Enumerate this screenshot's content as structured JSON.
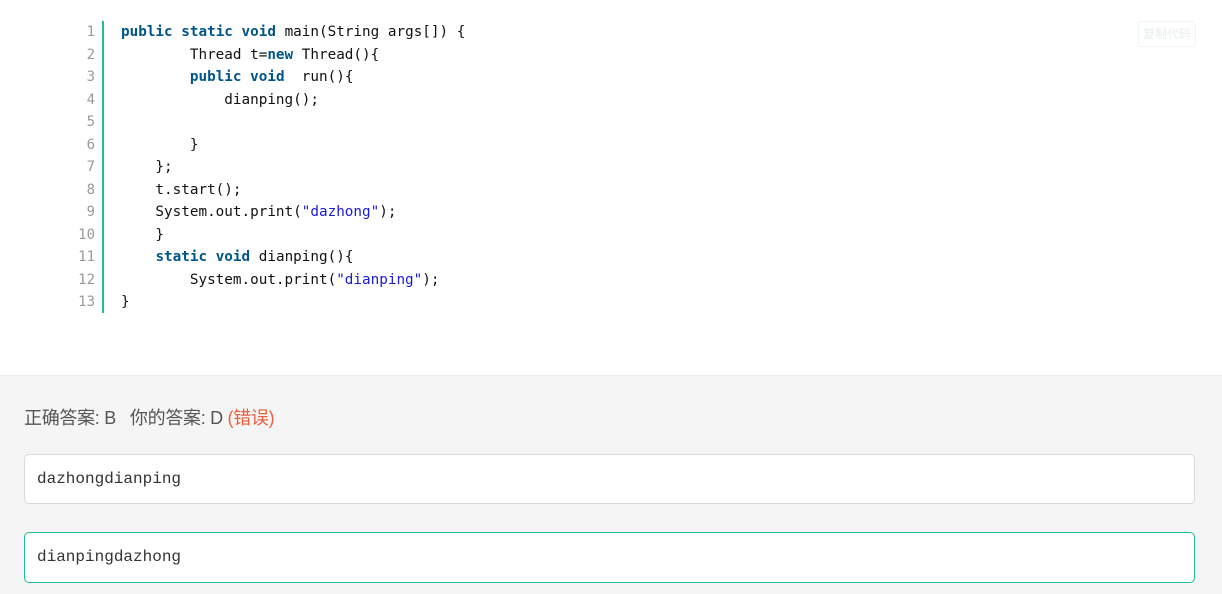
{
  "header": {
    "top_button_label": ""
  },
  "code": {
    "line_numbers": [
      "1",
      "2",
      "3",
      "4",
      "5",
      "6",
      "7",
      "8",
      "9",
      "10",
      "11",
      "12",
      "13"
    ],
    "copy_label": "复制代码"
  },
  "answer": {
    "correct_label": "正确答案: B",
    "your_label": "你的答案: D",
    "status": "(错误)"
  },
  "options": [
    {
      "text": "dazhongdianping"
    },
    {
      "text": "dianpingdazhong"
    }
  ],
  "colors": {
    "accent": "#1fbf96",
    "keyword": "#00558a",
    "string": "#1a1ad6",
    "wrong": "#e8603c"
  }
}
